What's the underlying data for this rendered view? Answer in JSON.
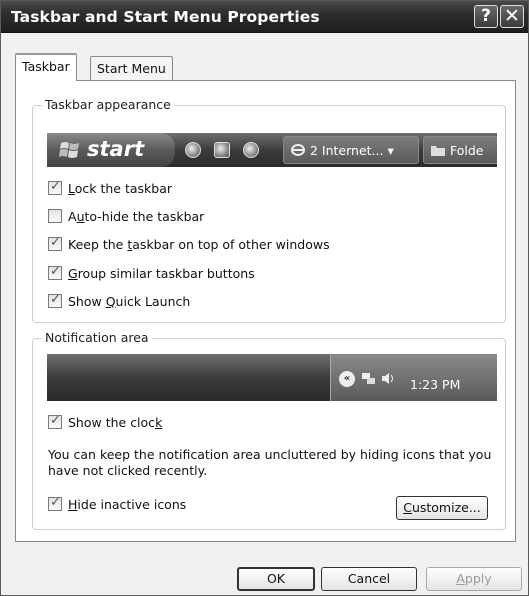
{
  "window": {
    "title": "Taskbar and Start Menu Properties",
    "help_glyph": "?",
    "close_glyph": "✕"
  },
  "tabs": [
    {
      "label": "Taskbar"
    },
    {
      "label": "Start Menu"
    }
  ],
  "appearance": {
    "group_label": "Taskbar appearance",
    "preview": {
      "start_label": "start",
      "item1": "2 Internet...",
      "item1_arrow": "▾",
      "item2": "Folde"
    },
    "options": [
      {
        "pre": "",
        "key": "L",
        "post": "ock the taskbar",
        "checked": true
      },
      {
        "pre": "A",
        "key": "u",
        "post": "to-hide the taskbar",
        "checked": false
      },
      {
        "pre": "Keep the ",
        "key": "t",
        "post": "askbar on top of other windows",
        "checked": true
      },
      {
        "pre": "",
        "key": "G",
        "post": "roup similar taskbar buttons",
        "checked": true
      },
      {
        "pre": "Show ",
        "key": "Q",
        "post": "uick Launch",
        "checked": true
      }
    ]
  },
  "notification": {
    "group_label": "Notification area",
    "chevron": "«",
    "clock": "1:23 PM",
    "show_clock": {
      "pre": "Show the cloc",
      "key": "k",
      "post": "",
      "checked": true
    },
    "description": "You can keep the notification area uncluttered by hiding icons that you have not clicked recently.",
    "hide_inactive": {
      "pre": "",
      "key": "H",
      "post": "ide inactive icons",
      "checked": true
    },
    "customize": {
      "pre": "",
      "key": "C",
      "post": "ustomize..."
    }
  },
  "buttons": {
    "ok": "OK",
    "cancel": "Cancel",
    "apply": {
      "pre": "",
      "key": "A",
      "post": "pply"
    }
  },
  "icons": {
    "ql1": "ie-icon",
    "ql2": "media-icon",
    "ql3": "media-player-icon",
    "tray1": "network-icon",
    "tray2": "volume-icon",
    "folder": "folder-icon"
  }
}
